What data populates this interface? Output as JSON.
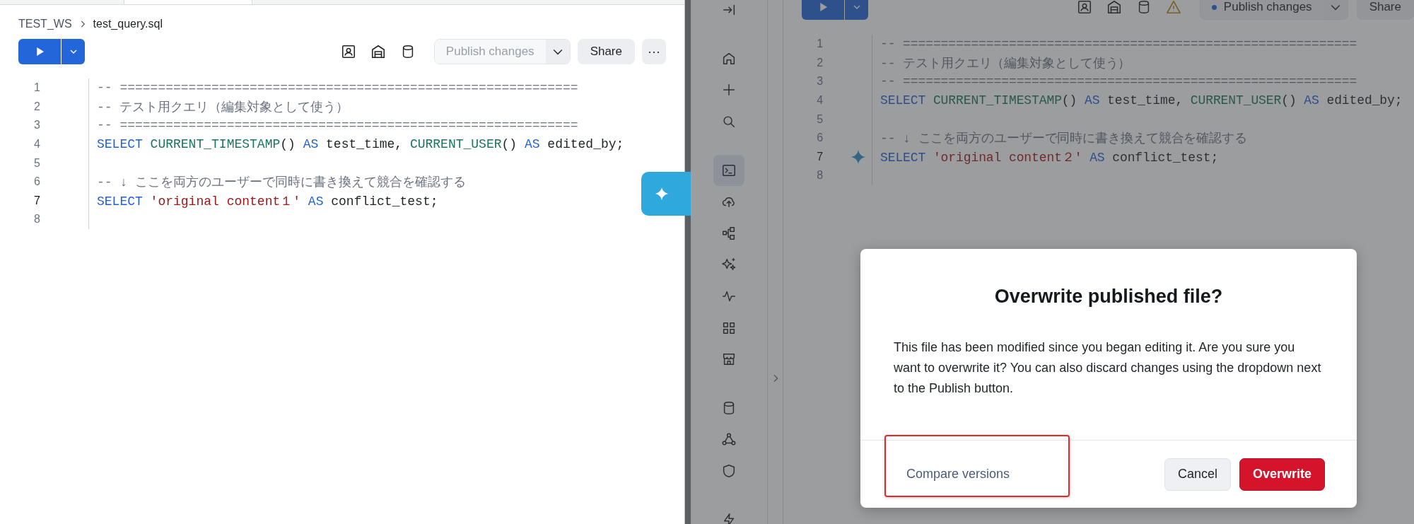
{
  "left_pane": {
    "breadcrumb": [
      "TEST_WS",
      "test_query.sql"
    ],
    "toolbar": {
      "publish": {
        "label": "Publish changes",
        "disabled": true
      },
      "share": "Share",
      "more": "⋯"
    },
    "editor": {
      "lines": [
        {
          "number": "1",
          "active": false,
          "tokens": [
            {
              "kind": "comment",
              "text": "-- ============================================================"
            }
          ]
        },
        {
          "number": "2",
          "active": false,
          "tokens": [
            {
              "kind": "comment",
              "text": "-- テスト用クエリ（編集対象として使う）"
            }
          ]
        },
        {
          "number": "3",
          "active": false,
          "tokens": [
            {
              "kind": "comment",
              "text": "-- ============================================================"
            }
          ]
        },
        {
          "number": "4",
          "active": false,
          "tokens": [
            {
              "kind": "keyword",
              "text": "SELECT"
            },
            {
              "kind": "function",
              "text": " CURRENT_TIMESTAMP"
            },
            {
              "kind": "plain",
              "text": "() "
            },
            {
              "kind": "keyword",
              "text": "AS"
            },
            {
              "kind": "plain",
              "text": " test_time, "
            },
            {
              "kind": "function",
              "text": "CURRENT_USER"
            },
            {
              "kind": "plain",
              "text": "() "
            },
            {
              "kind": "keyword",
              "text": "AS"
            },
            {
              "kind": "plain",
              "text": " edited_by;"
            }
          ]
        },
        {
          "number": "5",
          "active": false
        },
        {
          "number": "6",
          "active": false,
          "tokens": [
            {
              "kind": "comment",
              "text": "-- ↓ ここを両方のユーザーで同時に書き換えて競合を確認する"
            }
          ]
        },
        {
          "number": "7",
          "active": true,
          "tokens": [
            {
              "kind": "keyword",
              "text": "SELECT"
            },
            {
              "kind": "string",
              "text": " 'original content１'"
            },
            {
              "kind": "keyword",
              "text": " AS"
            },
            {
              "kind": "plain",
              "text": " conflict_test;"
            }
          ]
        },
        {
          "number": "8",
          "active": false
        }
      ]
    }
  },
  "right_pane": {
    "sidebar": {
      "groups": [
        {
          "items": [
            {
              "kind": "collapse",
              "selected": false
            }
          ]
        },
        {
          "items": [
            {
              "kind": "home",
              "selected": false
            },
            {
              "kind": "plus",
              "selected": false
            },
            {
              "kind": "search",
              "selected": false
            }
          ]
        },
        {
          "items": [
            {
              "kind": "terminal",
              "selected": true
            },
            {
              "kind": "cloud",
              "selected": false
            },
            {
              "kind": "nodes",
              "selected": false
            },
            {
              "kind": "sparkles",
              "selected": false
            },
            {
              "kind": "activity",
              "selected": false
            },
            {
              "kind": "grid",
              "selected": false
            },
            {
              "kind": "store",
              "selected": false
            }
          ]
        },
        {
          "items": [
            {
              "kind": "database",
              "selected": false
            },
            {
              "kind": "network",
              "selected": false
            },
            {
              "kind": "shield",
              "selected": false
            }
          ]
        },
        {
          "items": [
            {
              "kind": "bolt",
              "selected": false
            }
          ]
        }
      ]
    },
    "toolbar": {
      "publish": {
        "label": "Publish changes",
        "modified": true
      },
      "share": "Share"
    },
    "editor": {
      "lines": [
        {
          "number": "1",
          "active": false,
          "ai_marker": false,
          "tokens": [
            {
              "kind": "comment",
              "text": "-- ============================================================"
            }
          ]
        },
        {
          "number": "2",
          "active": false,
          "ai_marker": false,
          "tokens": [
            {
              "kind": "comment",
              "text": "-- テスト用クエリ（編集対象として使う）"
            }
          ]
        },
        {
          "number": "3",
          "active": false,
          "ai_marker": false,
          "tokens": [
            {
              "kind": "comment",
              "text": "-- ============================================================"
            }
          ]
        },
        {
          "number": "4",
          "active": false,
          "ai_marker": false,
          "tokens": [
            {
              "kind": "keyword",
              "text": "SELECT"
            },
            {
              "kind": "function",
              "text": " CURRENT_TIMESTAMP"
            },
            {
              "kind": "plain",
              "text": "() "
            },
            {
              "kind": "keyword",
              "text": "AS"
            },
            {
              "kind": "plain",
              "text": " test_time, "
            },
            {
              "kind": "function",
              "text": "CURRENT_USER"
            },
            {
              "kind": "plain",
              "text": "() "
            },
            {
              "kind": "keyword",
              "text": "AS"
            },
            {
              "kind": "plain",
              "text": " edited_by;"
            }
          ]
        },
        {
          "number": "5",
          "active": false,
          "ai_marker": false
        },
        {
          "number": "6",
          "active": false,
          "ai_marker": false,
          "tokens": [
            {
              "kind": "comment",
              "text": "-- ↓ ここを両方のユーザーで同時に書き換えて競合を確認する"
            }
          ]
        },
        {
          "number": "7",
          "active": true,
          "ai_marker": true,
          "tokens": [
            {
              "kind": "keyword",
              "text": "SELECT"
            },
            {
              "kind": "string",
              "text": " 'original content２'"
            },
            {
              "kind": "keyword",
              "text": " AS"
            },
            {
              "kind": "plain",
              "text": " conflict_test;"
            }
          ]
        },
        {
          "number": "8",
          "active": false,
          "ai_marker": false
        }
      ]
    },
    "dialog": {
      "title": "Overwrite published file?",
      "body": "This file has been modified since you began editing it. Are you sure you want to overwrite it? You can also discard changes using the dropdown next to the Publish button.",
      "link": {
        "label": "Compare versions",
        "highlighted": true
      },
      "buttons": [
        {
          "kind": "secondary",
          "label": "Cancel"
        },
        {
          "kind": "danger",
          "label": "Overwrite"
        }
      ]
    }
  }
}
